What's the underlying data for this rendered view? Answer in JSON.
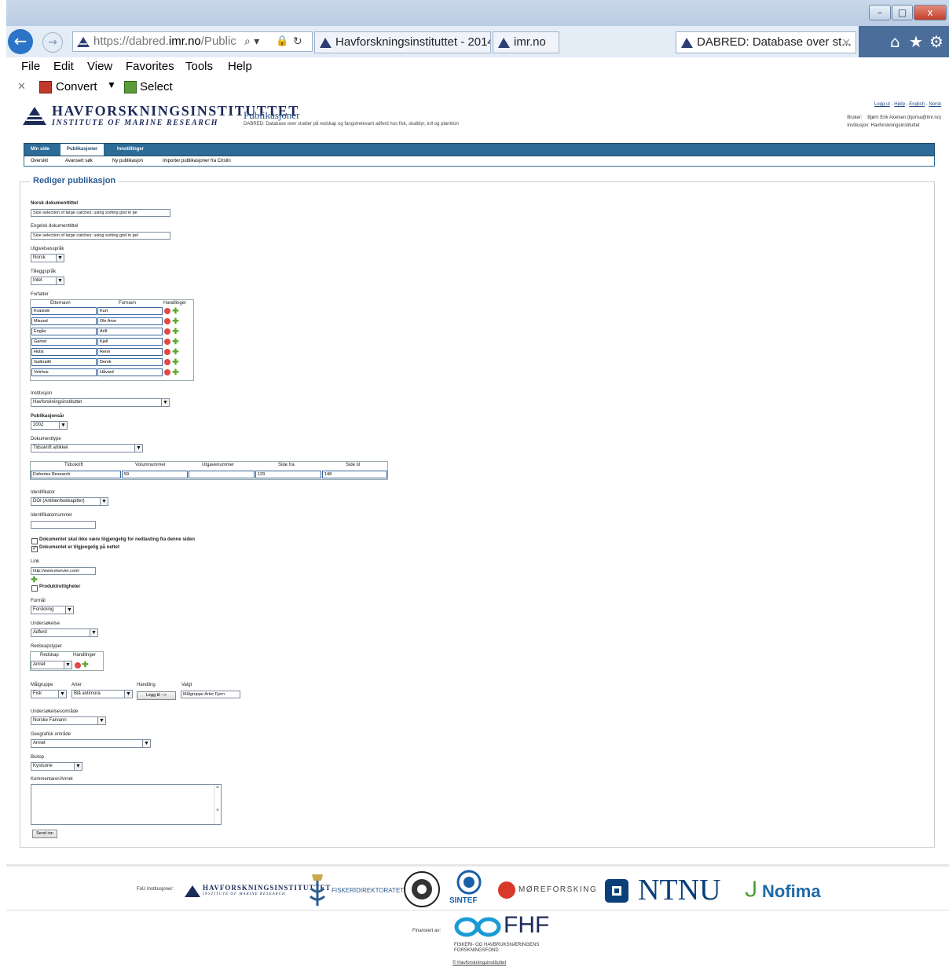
{
  "browser": {
    "address": {
      "scheme": "https://",
      "host_prefix": "dabred.",
      "host_domain": "imr.no",
      "path": "/Public"
    },
    "tabs": [
      {
        "label": "Havforskningsinstituttet - 2014"
      },
      {
        "label": "imr.no"
      },
      {
        "label": "DABRED: Database over st..."
      }
    ],
    "window_controls": {
      "minimize": "–",
      "maximize": "□",
      "close": "x"
    },
    "menu": [
      "File",
      "Edit",
      "View",
      "Favorites",
      "Tools",
      "Help"
    ],
    "command_bar": {
      "convert": "Convert",
      "select": "Select"
    }
  },
  "header": {
    "logo_line1": "HAVFORSKNINGSINSTITUTTET",
    "logo_line2": "INSTITUTE OF MARINE RESEARCH",
    "app_title": "Publikasjoner",
    "app_subtitle": "DABRED: Database over studier på redskap og fangstrelevant adferd hos fisk, skalldyr, kril og plankton",
    "links": [
      "Logg ut",
      "Hjelp",
      "English",
      "Norsk"
    ],
    "user_label": "Bruker:",
    "user_value": "Bjørn Erik Axelsen (bjorna@imr.no)",
    "inst_label": "Institusjon:",
    "inst_value": "Havforskningsinstituttet"
  },
  "nav": {
    "main": [
      "Min side",
      "Publikasjoner",
      "Innstillinger"
    ],
    "sub": [
      "Oversikt",
      "Avansert søk",
      "Ny publikasjon",
      "Importer publikasjoner fra Cristin"
    ]
  },
  "form": {
    "legend": "Rediger publikasjon",
    "norsk_title_label": "Norsk dokumenttittel",
    "norsk_title_value": "Size selection of large catches: using sorting grid in pe",
    "engelsk_title_label": "Engelsk dokumenttittel",
    "engelsk_title_value": "Size selection of large catches: using sorting grid in pel",
    "language_label": "Utgivelsesspråk",
    "language_value": "Norsk",
    "extra_language_label": "Tilleggspråk",
    "extra_language_value": "Intet",
    "authors_label": "Forfatter",
    "authors_headers": [
      "Etternavn",
      "Fornavn",
      "Handlinger"
    ],
    "authors": [
      {
        "last": "Kvalsvik",
        "first": "Kurt"
      },
      {
        "last": "Misund",
        "first": "Ole Arve"
      },
      {
        "last": "Engås",
        "first": "Arill"
      },
      {
        "last": "Gamst",
        "first": "Kjell"
      },
      {
        "last": "Holst",
        "first": "Rene"
      },
      {
        "last": "Galbraith",
        "first": "Derek"
      },
      {
        "last": "Vetrhus",
        "first": "Håvard"
      }
    ],
    "institution_label": "Institusjon",
    "institution_value": "Havforskningsinstituttet",
    "year_label": "Publikasjonsår",
    "year_value": "2002",
    "doctype_label": "Dokumenttype",
    "doctype_value": "Tidsskrift artikkel",
    "journal_headers": [
      "Tidsskrift",
      "Volumnummer",
      "Utgavenummer",
      "Side fra",
      "Side til"
    ],
    "journal_values": [
      "Fisheries Research",
      "59",
      "",
      "129",
      "148"
    ],
    "identifier_label": "Identifikator",
    "identifier_value": "DOI (Artikler/bokkapitler)",
    "identifier_number_label": "Identifikatornummer",
    "identifier_number_value": "",
    "chk_not_available": "Dokumentet skal ikke være tilgjengelig for nedlasting fra denne siden",
    "chk_online": "Dokumentet er tilgjengelig på nettet",
    "link_label": "Link",
    "link_value": "http://www.elsevier.com/",
    "chk_product_rights": "Produktrettigheter",
    "purpose_label": "Formål",
    "purpose_value": "Forskning",
    "study_label": "Undersøkelse",
    "study_value": "Adferd",
    "gear_label": "Redskapstyper",
    "gear_headers": [
      "Redskap",
      "Handlinger"
    ],
    "gear_value": "Annet",
    "target_label": "Målgruppe",
    "target_value": "Fisk",
    "species_label": "Arter",
    "species_value": "Blå antimora",
    "action_label": "Handling",
    "add_button": "Legg til -->",
    "chosen_label": "Valgt",
    "chosen_value": "Målgruppe Arter Fjern",
    "area_label": "Undersøkelsesområde",
    "area_value": "Norske Farvann",
    "geo_label": "Geografisk område",
    "geo_value": "Annet",
    "biotope_label": "Biotop",
    "biotope_value": "Kystsone",
    "comment_label": "Kommentarer/Annet",
    "submit_button": "Send inn"
  },
  "footer": {
    "partners_label": "FoU Institusjoner:",
    "partners": [
      "HAVFORSKNINGSINSTITUTTET",
      "INSTITUTE OF MARINE RESEARCH",
      "FISKERIDIREKTORATET",
      "SINTEF",
      "MØREFORSKING",
      "NTNU",
      "Nofima"
    ],
    "funded_label": "Finansiert av:",
    "fhf_name": "FHF",
    "fhf_sub1": "FISKERI- OG HAVBRUKSNÆRINGENS",
    "fhf_sub2": "FORSKNINGSFOND",
    "copyright": "© Havforskningsinstituttet"
  }
}
